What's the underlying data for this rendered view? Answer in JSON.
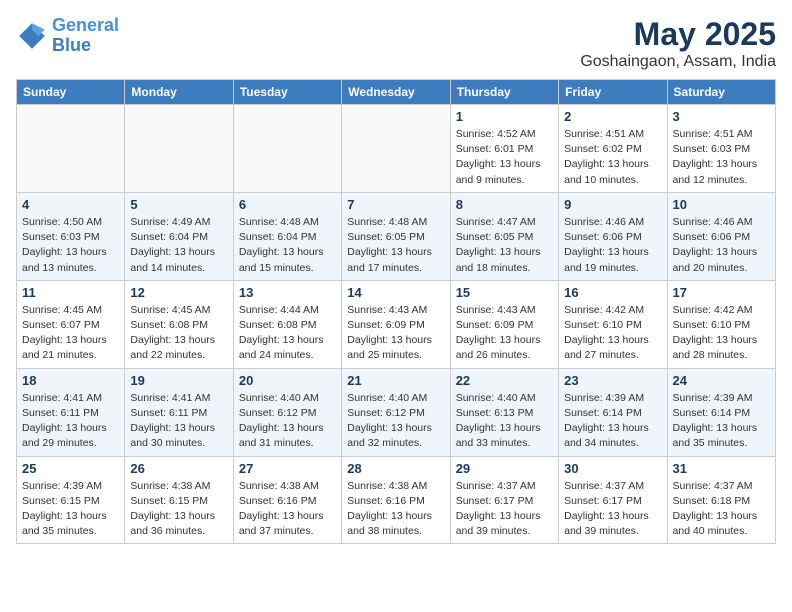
{
  "header": {
    "logo_line1": "General",
    "logo_line2": "Blue",
    "month": "May 2025",
    "location": "Goshaingaon, Assam, India"
  },
  "weekdays": [
    "Sunday",
    "Monday",
    "Tuesday",
    "Wednesday",
    "Thursday",
    "Friday",
    "Saturday"
  ],
  "weeks": [
    [
      {
        "day": "",
        "info": ""
      },
      {
        "day": "",
        "info": ""
      },
      {
        "day": "",
        "info": ""
      },
      {
        "day": "",
        "info": ""
      },
      {
        "day": "1",
        "info": "Sunrise: 4:52 AM\nSunset: 6:01 PM\nDaylight: 13 hours\nand 9 minutes."
      },
      {
        "day": "2",
        "info": "Sunrise: 4:51 AM\nSunset: 6:02 PM\nDaylight: 13 hours\nand 10 minutes."
      },
      {
        "day": "3",
        "info": "Sunrise: 4:51 AM\nSunset: 6:03 PM\nDaylight: 13 hours\nand 12 minutes."
      }
    ],
    [
      {
        "day": "4",
        "info": "Sunrise: 4:50 AM\nSunset: 6:03 PM\nDaylight: 13 hours\nand 13 minutes."
      },
      {
        "day": "5",
        "info": "Sunrise: 4:49 AM\nSunset: 6:04 PM\nDaylight: 13 hours\nand 14 minutes."
      },
      {
        "day": "6",
        "info": "Sunrise: 4:48 AM\nSunset: 6:04 PM\nDaylight: 13 hours\nand 15 minutes."
      },
      {
        "day": "7",
        "info": "Sunrise: 4:48 AM\nSunset: 6:05 PM\nDaylight: 13 hours\nand 17 minutes."
      },
      {
        "day": "8",
        "info": "Sunrise: 4:47 AM\nSunset: 6:05 PM\nDaylight: 13 hours\nand 18 minutes."
      },
      {
        "day": "9",
        "info": "Sunrise: 4:46 AM\nSunset: 6:06 PM\nDaylight: 13 hours\nand 19 minutes."
      },
      {
        "day": "10",
        "info": "Sunrise: 4:46 AM\nSunset: 6:06 PM\nDaylight: 13 hours\nand 20 minutes."
      }
    ],
    [
      {
        "day": "11",
        "info": "Sunrise: 4:45 AM\nSunset: 6:07 PM\nDaylight: 13 hours\nand 21 minutes."
      },
      {
        "day": "12",
        "info": "Sunrise: 4:45 AM\nSunset: 6:08 PM\nDaylight: 13 hours\nand 22 minutes."
      },
      {
        "day": "13",
        "info": "Sunrise: 4:44 AM\nSunset: 6:08 PM\nDaylight: 13 hours\nand 24 minutes."
      },
      {
        "day": "14",
        "info": "Sunrise: 4:43 AM\nSunset: 6:09 PM\nDaylight: 13 hours\nand 25 minutes."
      },
      {
        "day": "15",
        "info": "Sunrise: 4:43 AM\nSunset: 6:09 PM\nDaylight: 13 hours\nand 26 minutes."
      },
      {
        "day": "16",
        "info": "Sunrise: 4:42 AM\nSunset: 6:10 PM\nDaylight: 13 hours\nand 27 minutes."
      },
      {
        "day": "17",
        "info": "Sunrise: 4:42 AM\nSunset: 6:10 PM\nDaylight: 13 hours\nand 28 minutes."
      }
    ],
    [
      {
        "day": "18",
        "info": "Sunrise: 4:41 AM\nSunset: 6:11 PM\nDaylight: 13 hours\nand 29 minutes."
      },
      {
        "day": "19",
        "info": "Sunrise: 4:41 AM\nSunset: 6:11 PM\nDaylight: 13 hours\nand 30 minutes."
      },
      {
        "day": "20",
        "info": "Sunrise: 4:40 AM\nSunset: 6:12 PM\nDaylight: 13 hours\nand 31 minutes."
      },
      {
        "day": "21",
        "info": "Sunrise: 4:40 AM\nSunset: 6:12 PM\nDaylight: 13 hours\nand 32 minutes."
      },
      {
        "day": "22",
        "info": "Sunrise: 4:40 AM\nSunset: 6:13 PM\nDaylight: 13 hours\nand 33 minutes."
      },
      {
        "day": "23",
        "info": "Sunrise: 4:39 AM\nSunset: 6:14 PM\nDaylight: 13 hours\nand 34 minutes."
      },
      {
        "day": "24",
        "info": "Sunrise: 4:39 AM\nSunset: 6:14 PM\nDaylight: 13 hours\nand 35 minutes."
      }
    ],
    [
      {
        "day": "25",
        "info": "Sunrise: 4:39 AM\nSunset: 6:15 PM\nDaylight: 13 hours\nand 35 minutes."
      },
      {
        "day": "26",
        "info": "Sunrise: 4:38 AM\nSunset: 6:15 PM\nDaylight: 13 hours\nand 36 minutes."
      },
      {
        "day": "27",
        "info": "Sunrise: 4:38 AM\nSunset: 6:16 PM\nDaylight: 13 hours\nand 37 minutes."
      },
      {
        "day": "28",
        "info": "Sunrise: 4:38 AM\nSunset: 6:16 PM\nDaylight: 13 hours\nand 38 minutes."
      },
      {
        "day": "29",
        "info": "Sunrise: 4:37 AM\nSunset: 6:17 PM\nDaylight: 13 hours\nand 39 minutes."
      },
      {
        "day": "30",
        "info": "Sunrise: 4:37 AM\nSunset: 6:17 PM\nDaylight: 13 hours\nand 39 minutes."
      },
      {
        "day": "31",
        "info": "Sunrise: 4:37 AM\nSunset: 6:18 PM\nDaylight: 13 hours\nand 40 minutes."
      }
    ]
  ]
}
